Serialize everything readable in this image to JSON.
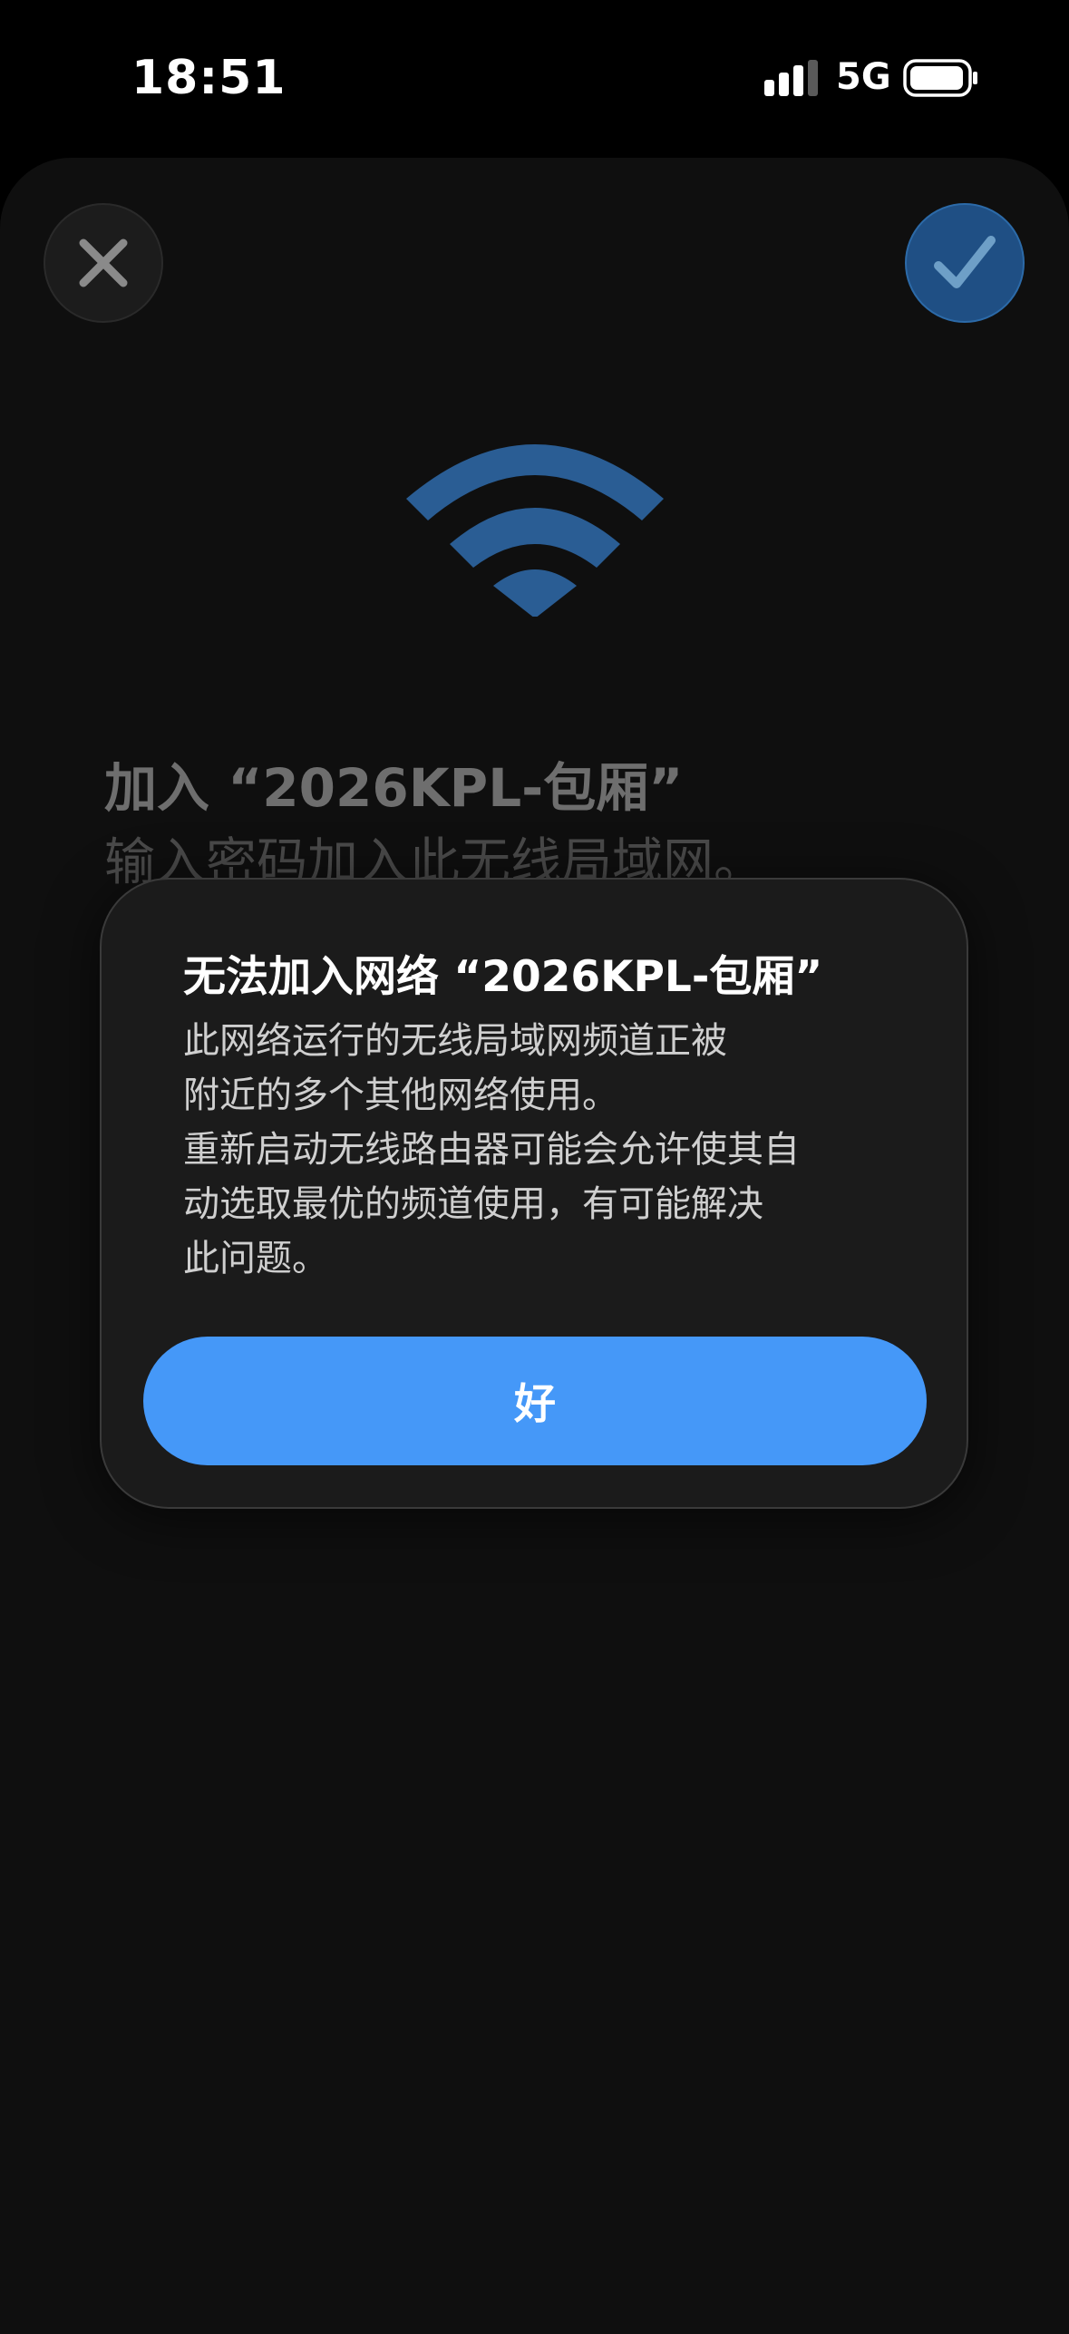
{
  "status_bar": {
    "time": "18:51",
    "network": "5G",
    "icons": [
      "cellular-signal-icon",
      "battery-icon"
    ]
  },
  "sheet": {
    "title": "加入 “2026KPL-包厢”",
    "subtitle": "输入密码加入此无线局域网。",
    "icons": [
      "close-icon",
      "checkmark-icon",
      "wifi-icon"
    ],
    "accent_color": "#2c6aa8"
  },
  "alert": {
    "title": "无法加入网络 “2026KPL-包厢”",
    "message_lines": [
      "此网络运行的无线局域网频道正被",
      "附近的多个其他网络使用。",
      "重新启动无线路由器可能会允许使其自",
      "动选取最优的频道使用，有可能解决",
      "此问题。"
    ],
    "ok_label": "好",
    "button_color": "#4598f8"
  }
}
